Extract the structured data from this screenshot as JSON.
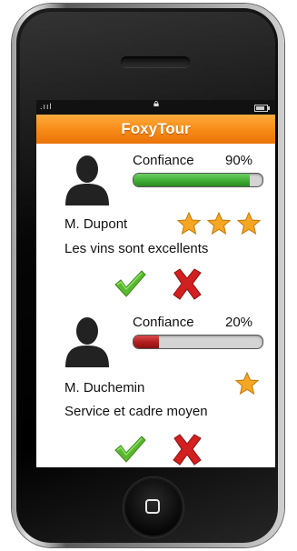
{
  "app": {
    "title": "FoxyTour"
  },
  "status_bar": {
    "signal": ".ııl",
    "lock": "lock-icon",
    "battery": "battery-icon"
  },
  "reviews": [
    {
      "confidence_label": "Confiance",
      "confidence_value": "90%",
      "confidence_fraction": 0.9,
      "bar_color": "#3fae33",
      "name": "M. Dupont",
      "stars": 3,
      "comment": "Les vins sont excellents"
    },
    {
      "confidence_label": "Confiance",
      "confidence_value": "20%",
      "confidence_fraction": 0.2,
      "bar_color": "#b01d1d",
      "name": "M. Duchemin",
      "stars": 1,
      "comment": "Service et cadre moyen"
    }
  ],
  "icons": {
    "approve": "checkmark-icon",
    "reject": "cross-icon",
    "rating": "star-icon",
    "home": "home-button-icon"
  },
  "colors": {
    "accent": "#f68a15",
    "star": "#f5a623",
    "approve": "#5cb82e",
    "reject": "#d21f1f"
  }
}
